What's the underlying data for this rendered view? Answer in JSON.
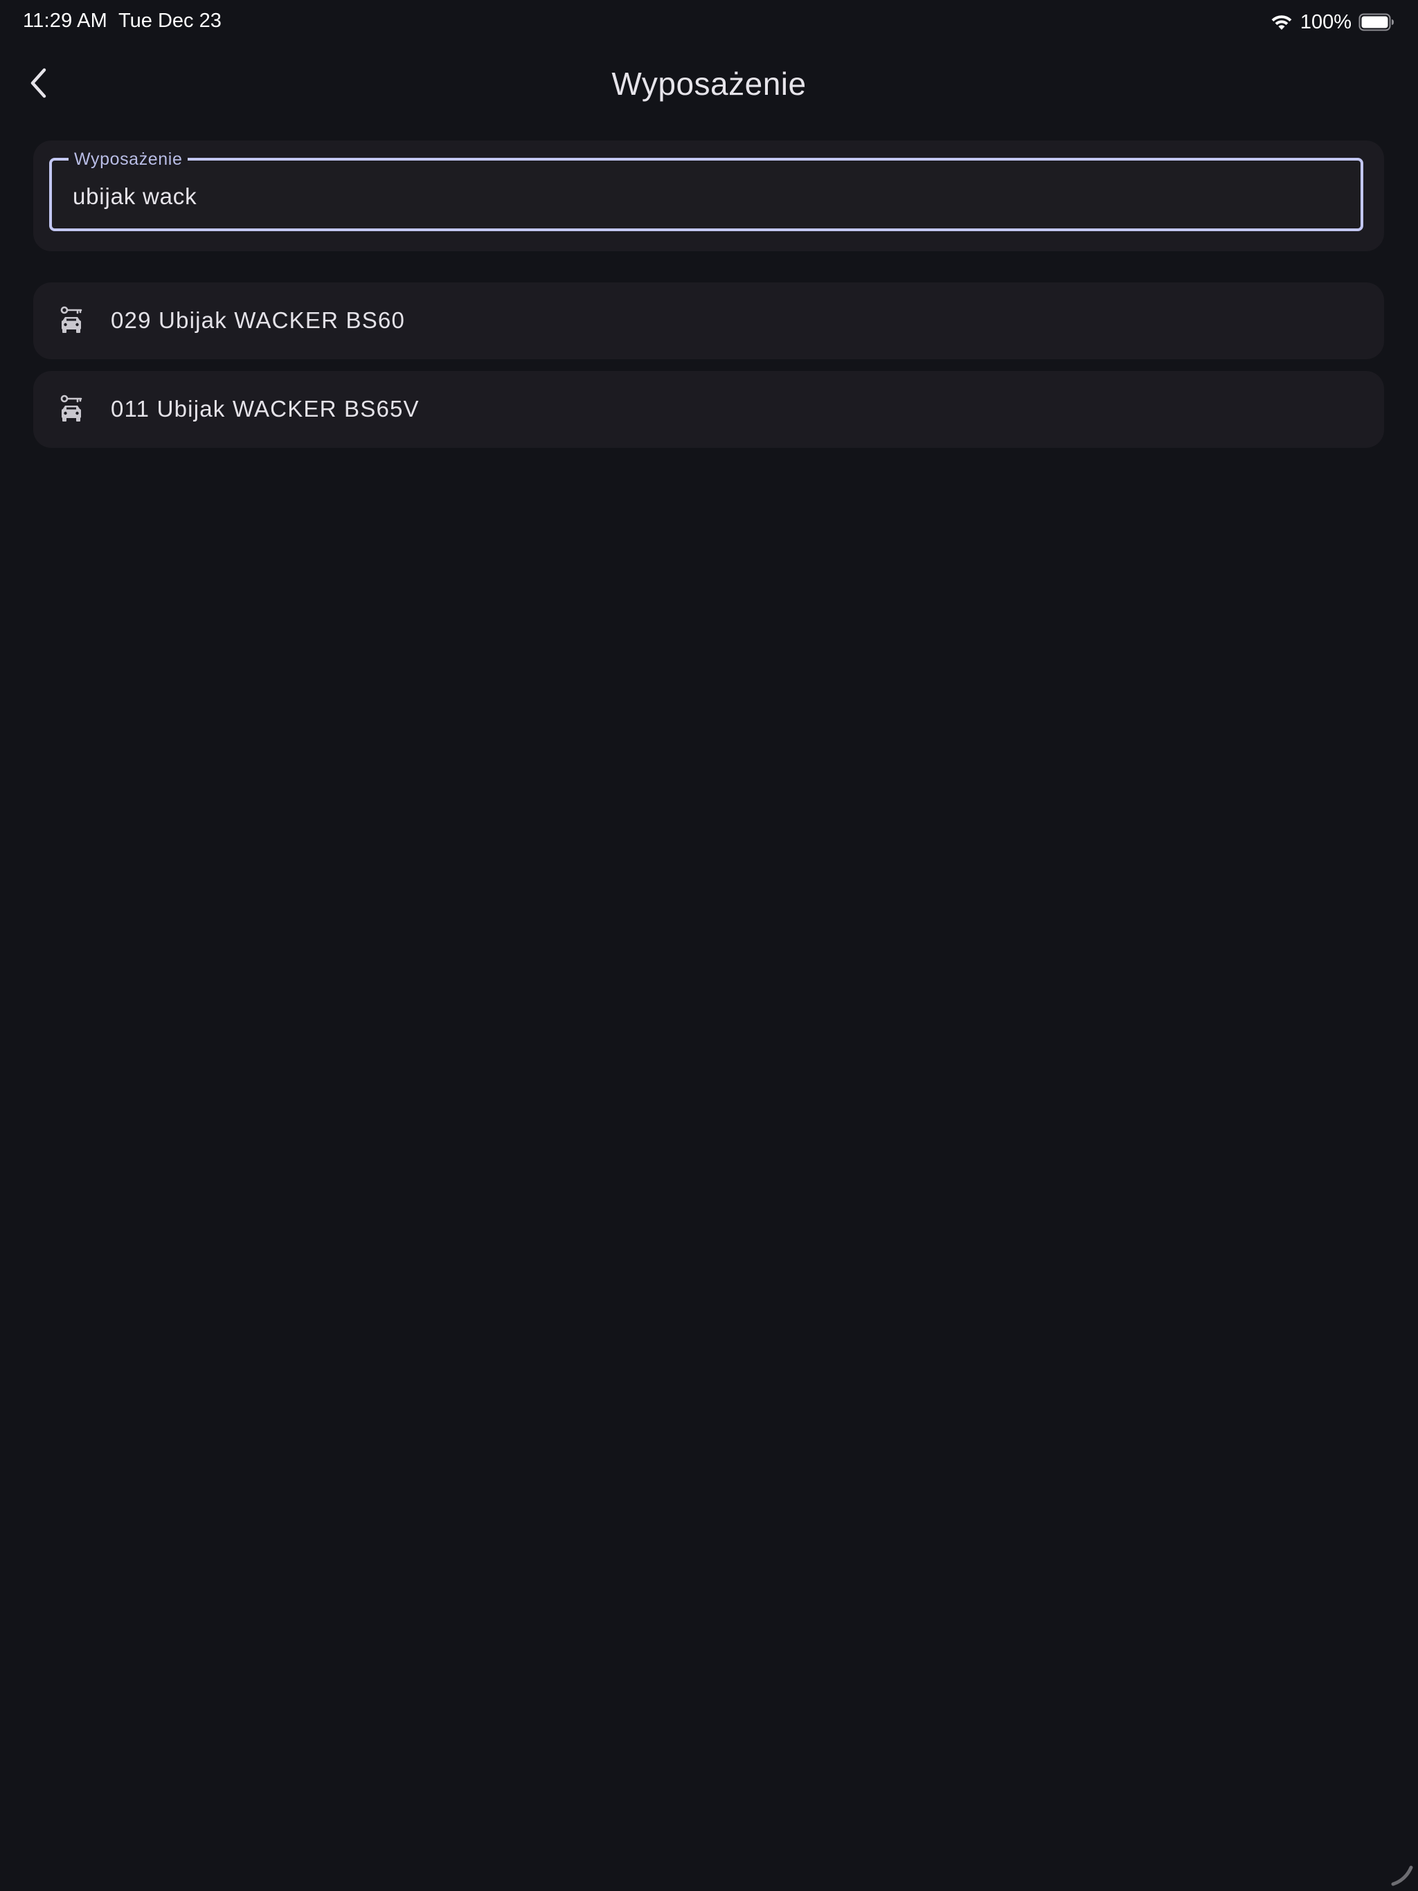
{
  "status_bar": {
    "time": "11:29 AM",
    "date": "Tue Dec 23",
    "battery_percent": "100%",
    "battery_level": 1.0,
    "wifi_icon": "wifi-icon",
    "battery_icon": "battery-icon"
  },
  "app_bar": {
    "title": "Wyposażenie",
    "back_icon": "chevron-left-icon"
  },
  "search": {
    "label": "Wyposażenie",
    "value": "ubijak wack"
  },
  "results": [
    {
      "label": "029 Ubijak WACKER BS60",
      "icon": "equipment-key-car-icon"
    },
    {
      "label": "011 Ubijak WACKER BS65V",
      "icon": "equipment-key-car-icon"
    }
  ],
  "colors": {
    "background": "#121318",
    "surface": "#1c1b21",
    "accent": "#c3c7f3",
    "text": "#e4e2e8"
  }
}
